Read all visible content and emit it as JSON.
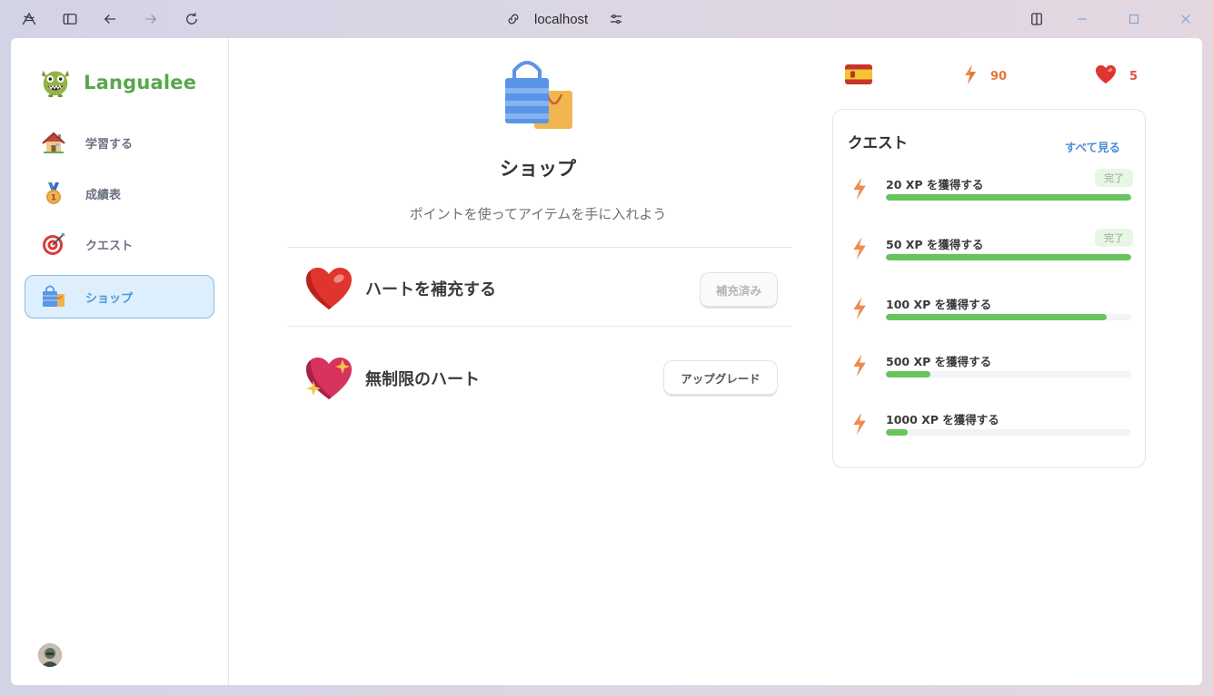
{
  "browser": {
    "url": "localhost"
  },
  "sidebar": {
    "brand": "Langualee",
    "items": [
      {
        "label": "学習する",
        "icon": "house-icon"
      },
      {
        "label": "成績表",
        "icon": "medal-icon"
      },
      {
        "label": "クエスト",
        "icon": "target-icon"
      },
      {
        "label": "ショップ",
        "icon": "shopping-bag-icon",
        "active": true
      }
    ]
  },
  "header_stats": {
    "language_flag": "spain-flag-icon",
    "xp": "90",
    "hearts": "5"
  },
  "shop": {
    "title": "ショップ",
    "subtitle": "ポイントを使ってアイテムを手に入れよう",
    "items": [
      {
        "label": "ハートを補充する",
        "button": "補充済み",
        "button_state": "disabled"
      },
      {
        "label": "無制限のハート",
        "button": "アップグレード",
        "button_state": "enabled"
      }
    ]
  },
  "quests": {
    "title": "クエスト",
    "view_all": "すべて見る",
    "items": [
      {
        "label": "20 XP を獲得する",
        "progress": 1.0,
        "badge": "完了"
      },
      {
        "label": "50 XP を獲得する",
        "progress": 1.0,
        "badge": "完了"
      },
      {
        "label": "100 XP を獲得する",
        "progress": 0.9,
        "badge": ""
      },
      {
        "label": "500 XP を獲得する",
        "progress": 0.18,
        "badge": ""
      },
      {
        "label": "1000 XP を獲得する",
        "progress": 0.09,
        "badge": ""
      }
    ]
  },
  "colors": {
    "brand": "#58a74c",
    "progress": "#69c35f",
    "active_nav": "#ddeefc",
    "link": "#4a8fd6",
    "xp": "#e8743a",
    "hearts": "#e0533f"
  }
}
